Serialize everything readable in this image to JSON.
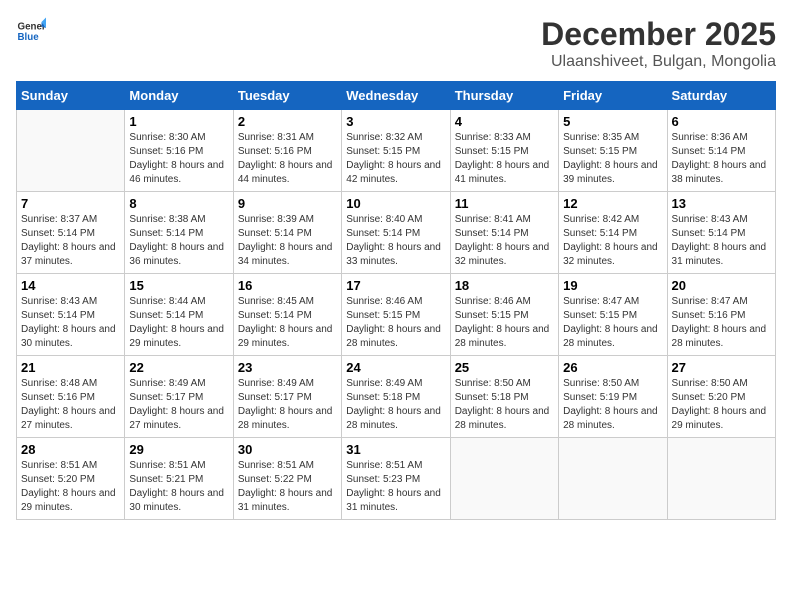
{
  "logo": {
    "general": "General",
    "blue": "Blue"
  },
  "header": {
    "month": "December 2025",
    "location": "Ulaanshiveet, Bulgan, Mongolia"
  },
  "weekdays": [
    "Sunday",
    "Monday",
    "Tuesday",
    "Wednesday",
    "Thursday",
    "Friday",
    "Saturday"
  ],
  "weeks": [
    [
      {
        "day": "",
        "sunrise": "",
        "sunset": "",
        "daylight": ""
      },
      {
        "day": "1",
        "sunrise": "Sunrise: 8:30 AM",
        "sunset": "Sunset: 5:16 PM",
        "daylight": "Daylight: 8 hours and 46 minutes."
      },
      {
        "day": "2",
        "sunrise": "Sunrise: 8:31 AM",
        "sunset": "Sunset: 5:16 PM",
        "daylight": "Daylight: 8 hours and 44 minutes."
      },
      {
        "day": "3",
        "sunrise": "Sunrise: 8:32 AM",
        "sunset": "Sunset: 5:15 PM",
        "daylight": "Daylight: 8 hours and 42 minutes."
      },
      {
        "day": "4",
        "sunrise": "Sunrise: 8:33 AM",
        "sunset": "Sunset: 5:15 PM",
        "daylight": "Daylight: 8 hours and 41 minutes."
      },
      {
        "day": "5",
        "sunrise": "Sunrise: 8:35 AM",
        "sunset": "Sunset: 5:15 PM",
        "daylight": "Daylight: 8 hours and 39 minutes."
      },
      {
        "day": "6",
        "sunrise": "Sunrise: 8:36 AM",
        "sunset": "Sunset: 5:14 PM",
        "daylight": "Daylight: 8 hours and 38 minutes."
      }
    ],
    [
      {
        "day": "7",
        "sunrise": "Sunrise: 8:37 AM",
        "sunset": "Sunset: 5:14 PM",
        "daylight": "Daylight: 8 hours and 37 minutes."
      },
      {
        "day": "8",
        "sunrise": "Sunrise: 8:38 AM",
        "sunset": "Sunset: 5:14 PM",
        "daylight": "Daylight: 8 hours and 36 minutes."
      },
      {
        "day": "9",
        "sunrise": "Sunrise: 8:39 AM",
        "sunset": "Sunset: 5:14 PM",
        "daylight": "Daylight: 8 hours and 34 minutes."
      },
      {
        "day": "10",
        "sunrise": "Sunrise: 8:40 AM",
        "sunset": "Sunset: 5:14 PM",
        "daylight": "Daylight: 8 hours and 33 minutes."
      },
      {
        "day": "11",
        "sunrise": "Sunrise: 8:41 AM",
        "sunset": "Sunset: 5:14 PM",
        "daylight": "Daylight: 8 hours and 32 minutes."
      },
      {
        "day": "12",
        "sunrise": "Sunrise: 8:42 AM",
        "sunset": "Sunset: 5:14 PM",
        "daylight": "Daylight: 8 hours and 32 minutes."
      },
      {
        "day": "13",
        "sunrise": "Sunrise: 8:43 AM",
        "sunset": "Sunset: 5:14 PM",
        "daylight": "Daylight: 8 hours and 31 minutes."
      }
    ],
    [
      {
        "day": "14",
        "sunrise": "Sunrise: 8:43 AM",
        "sunset": "Sunset: 5:14 PM",
        "daylight": "Daylight: 8 hours and 30 minutes."
      },
      {
        "day": "15",
        "sunrise": "Sunrise: 8:44 AM",
        "sunset": "Sunset: 5:14 PM",
        "daylight": "Daylight: 8 hours and 29 minutes."
      },
      {
        "day": "16",
        "sunrise": "Sunrise: 8:45 AM",
        "sunset": "Sunset: 5:14 PM",
        "daylight": "Daylight: 8 hours and 29 minutes."
      },
      {
        "day": "17",
        "sunrise": "Sunrise: 8:46 AM",
        "sunset": "Sunset: 5:15 PM",
        "daylight": "Daylight: 8 hours and 28 minutes."
      },
      {
        "day": "18",
        "sunrise": "Sunrise: 8:46 AM",
        "sunset": "Sunset: 5:15 PM",
        "daylight": "Daylight: 8 hours and 28 minutes."
      },
      {
        "day": "19",
        "sunrise": "Sunrise: 8:47 AM",
        "sunset": "Sunset: 5:15 PM",
        "daylight": "Daylight: 8 hours and 28 minutes."
      },
      {
        "day": "20",
        "sunrise": "Sunrise: 8:47 AM",
        "sunset": "Sunset: 5:16 PM",
        "daylight": "Daylight: 8 hours and 28 minutes."
      }
    ],
    [
      {
        "day": "21",
        "sunrise": "Sunrise: 8:48 AM",
        "sunset": "Sunset: 5:16 PM",
        "daylight": "Daylight: 8 hours and 27 minutes."
      },
      {
        "day": "22",
        "sunrise": "Sunrise: 8:49 AM",
        "sunset": "Sunset: 5:17 PM",
        "daylight": "Daylight: 8 hours and 27 minutes."
      },
      {
        "day": "23",
        "sunrise": "Sunrise: 8:49 AM",
        "sunset": "Sunset: 5:17 PM",
        "daylight": "Daylight: 8 hours and 28 minutes."
      },
      {
        "day": "24",
        "sunrise": "Sunrise: 8:49 AM",
        "sunset": "Sunset: 5:18 PM",
        "daylight": "Daylight: 8 hours and 28 minutes."
      },
      {
        "day": "25",
        "sunrise": "Sunrise: 8:50 AM",
        "sunset": "Sunset: 5:18 PM",
        "daylight": "Daylight: 8 hours and 28 minutes."
      },
      {
        "day": "26",
        "sunrise": "Sunrise: 8:50 AM",
        "sunset": "Sunset: 5:19 PM",
        "daylight": "Daylight: 8 hours and 28 minutes."
      },
      {
        "day": "27",
        "sunrise": "Sunrise: 8:50 AM",
        "sunset": "Sunset: 5:20 PM",
        "daylight": "Daylight: 8 hours and 29 minutes."
      }
    ],
    [
      {
        "day": "28",
        "sunrise": "Sunrise: 8:51 AM",
        "sunset": "Sunset: 5:20 PM",
        "daylight": "Daylight: 8 hours and 29 minutes."
      },
      {
        "day": "29",
        "sunrise": "Sunrise: 8:51 AM",
        "sunset": "Sunset: 5:21 PM",
        "daylight": "Daylight: 8 hours and 30 minutes."
      },
      {
        "day": "30",
        "sunrise": "Sunrise: 8:51 AM",
        "sunset": "Sunset: 5:22 PM",
        "daylight": "Daylight: 8 hours and 31 minutes."
      },
      {
        "day": "31",
        "sunrise": "Sunrise: 8:51 AM",
        "sunset": "Sunset: 5:23 PM",
        "daylight": "Daylight: 8 hours and 31 minutes."
      },
      {
        "day": "",
        "sunrise": "",
        "sunset": "",
        "daylight": ""
      },
      {
        "day": "",
        "sunrise": "",
        "sunset": "",
        "daylight": ""
      },
      {
        "day": "",
        "sunrise": "",
        "sunset": "",
        "daylight": ""
      }
    ]
  ]
}
